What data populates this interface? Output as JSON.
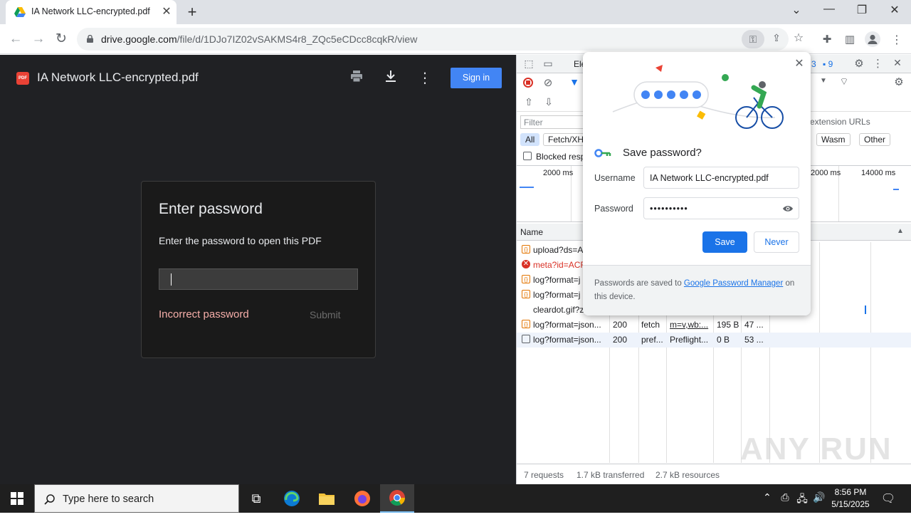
{
  "browser": {
    "tab_title": "IA Network LLC-encrypted.pdf -",
    "tab_close": "✕",
    "new_tab": "+",
    "url_host": "drive.google.com",
    "url_path": "/file/d/1DJo7IZ02vSAKMS4r8_ZQc5eCDcc8cqkR/view",
    "window_controls": {
      "chevron": "⌄",
      "minimize": "—",
      "restore": "❐",
      "close": "✕"
    }
  },
  "pdf_viewer": {
    "file_title": "IA Network LLC-encrypted.pdf",
    "file_icon_text": "PDF",
    "sign_in": "Sign in",
    "dialog": {
      "heading": "Enter password",
      "prompt": "Enter the password to open this PDF",
      "error": "Incorrect password",
      "submit": "Submit"
    }
  },
  "devtools": {
    "tab_partial": "Ele",
    "issues_count_a": "3",
    "issues_count_b": "9",
    "filter_placeholder": "Filter",
    "extension_urls": "extension URLs",
    "type_filters": [
      "All",
      "Fetch/XH",
      "Wasm",
      "Other"
    ],
    "blocked_label": "Blocked resp",
    "timeline_ticks": [
      "2000 ms",
      "2000 ms",
      "14000 ms"
    ],
    "column_name": "Name",
    "requests": [
      {
        "name": "upload?ds=A",
        "status": "",
        "type": "",
        "initiator": "",
        "size": "",
        "time": "",
        "kind": "xhr"
      },
      {
        "name": "meta?id=ACF",
        "status": "",
        "type": "",
        "initiator": "",
        "size": "",
        "time": "",
        "kind": "error"
      },
      {
        "name": "log?format=j",
        "status": "",
        "type": "",
        "initiator": "",
        "size": "",
        "time": "",
        "kind": "xhr"
      },
      {
        "name": "log?format=j",
        "status": "",
        "type": "",
        "initiator": "",
        "size": "",
        "time": "",
        "kind": "xhr"
      },
      {
        "name": "cleardot.gif?z",
        "status": "",
        "type": "",
        "initiator": "",
        "size": "",
        "time": "",
        "kind": "none"
      },
      {
        "name": "log?format=json...",
        "status": "200",
        "type": "fetch",
        "initiator": "m=v,wb:...",
        "size": "195 B",
        "time": "47 ...",
        "kind": "xhr"
      },
      {
        "name": "log?format=json...",
        "status": "200",
        "type": "pref...",
        "initiator": "Preflight...",
        "size": "0 B",
        "time": "53 ...",
        "kind": "doc"
      }
    ],
    "status_requests": "7 requests",
    "status_transferred": "1.7 kB transferred",
    "status_resources": "2.7 kB resources"
  },
  "save_password_popup": {
    "title": "Save password?",
    "username_label": "Username",
    "username_value": "IA Network LLC-encrypted.pdf",
    "password_label": "Password",
    "password_value": "••••••••••",
    "save": "Save",
    "never": "Never",
    "footer_prefix": "Passwords are saved to ",
    "footer_link": "Google Password Manager",
    "footer_suffix": " on this device.",
    "close": "✕"
  },
  "watermark": "ANY RUN",
  "taskbar": {
    "search_placeholder": "Type here to search",
    "time": "8:56 PM",
    "date": "5/15/2025"
  },
  "colors": {
    "accent": "#1a73e8",
    "signin": "#4285f4",
    "error_text": "#f6aea9",
    "viewer_bg": "#202124"
  }
}
